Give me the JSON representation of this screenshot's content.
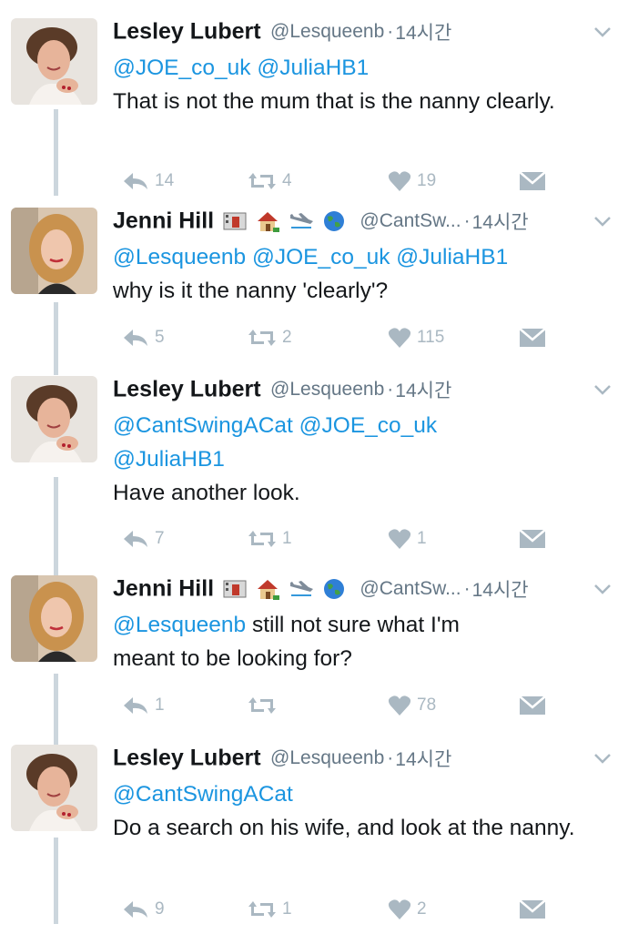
{
  "tweets": [
    {
      "name": "Lesley Lubert",
      "handle": "@Lesqueenb",
      "time": "14시간",
      "mentions": [
        "@JOE_co_uk",
        "@JuliaHB1"
      ],
      "text": "That is not the mum that is the nanny clearly.",
      "replies": "14",
      "retweets": "4",
      "likes": "19"
    },
    {
      "name": "Jenni Hill",
      "handle": "@CantSw...",
      "time": "14시간",
      "emojis": [
        "cinema-icon",
        "house-icon",
        "airplane-icon",
        "globe-icon"
      ],
      "mentions": [
        "@Lesqueenb",
        "@JOE_co_uk",
        "@JuliaHB1"
      ],
      "text": "why is it the nanny 'clearly'?",
      "replies": "5",
      "retweets": "2",
      "likes": "115"
    },
    {
      "name": "Lesley Lubert",
      "handle": "@Lesqueenb",
      "time": "14시간",
      "mentions": [
        "@CantSwingACat",
        "@JOE_co_uk",
        "@JuliaHB1"
      ],
      "text": "Have another look.",
      "replies": "7",
      "retweets": "1",
      "likes": "1"
    },
    {
      "name": "Jenni Hill",
      "handle": "@CantSw...",
      "time": "14시간",
      "emojis": [
        "cinema-icon",
        "house-icon",
        "airplane-icon",
        "globe-icon"
      ],
      "mentions": [
        "@Lesqueenb"
      ],
      "text_line1": "still not sure what I'm",
      "text_line2": "meant to be looking for?",
      "replies": "1",
      "retweets": "",
      "likes": "78"
    },
    {
      "name": "Lesley Lubert",
      "handle": "@Lesqueenb",
      "time": "14시간",
      "mentions": [
        "@CantSwingACat"
      ],
      "text": "Do a search on his wife, and look at the nanny.",
      "replies": "9",
      "retweets": "1",
      "likes": "2"
    }
  ],
  "separator": "·",
  "colors": {
    "link": "#1b95e0",
    "muted": "#657786",
    "icon": "#aab8c2",
    "thread": "#ccd6dd"
  }
}
